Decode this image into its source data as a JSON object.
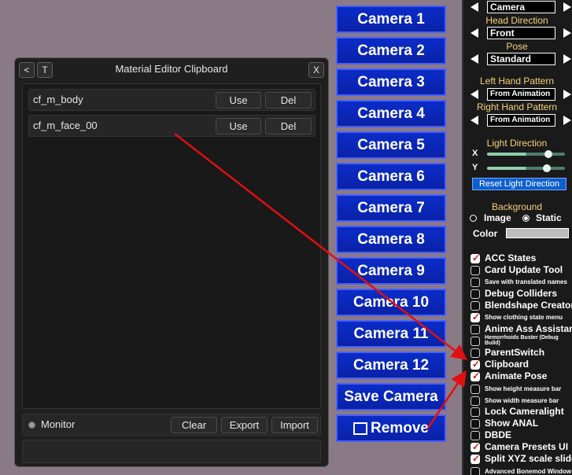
{
  "clipboard": {
    "title": "Material Editor Clipboard",
    "back_label": "<",
    "t_label": "T",
    "close_label": "X",
    "rows": [
      {
        "name": "cf_m_body",
        "use": "Use",
        "del": "Del"
      },
      {
        "name": "cf_m_face_00",
        "use": "Use",
        "del": "Del"
      }
    ],
    "monitor_label": "Monitor",
    "clear_label": "Clear",
    "export_label": "Export",
    "import_label": "Import"
  },
  "cameras": {
    "items": [
      "Camera 1",
      "Camera 2",
      "Camera 3",
      "Camera 4",
      "Camera 5",
      "Camera 6",
      "Camera 7",
      "Camera 8",
      "Camera 9",
      "Camera 10",
      "Camera 11",
      "Camera 12"
    ],
    "save_label": "Save Camera",
    "remove_label": "Remove"
  },
  "right_panel": {
    "camera_value": "Camera",
    "head_direction_label": "Head Direction",
    "head_direction_value": "Front",
    "pose_label": "Pose",
    "pose_value": "Standard",
    "left_hand_label": "Left Hand Pattern",
    "left_hand_value": "From Animation",
    "right_hand_label": "Right Hand Pattern",
    "right_hand_value": "From Animation",
    "light_direction_label": "Light Direction",
    "light_x_label": "X",
    "light_y_label": "Y",
    "light_x_value": 0.5,
    "light_y_value": 0.5,
    "reset_light_label": "Reset Light Direction",
    "background_label": "Background",
    "bg_image_label": "Image",
    "bg_static_label": "Static",
    "bg_selected": "Static",
    "color_label": "Color",
    "color_value": "#bdbdbd",
    "toggles": [
      {
        "label": "ACC States",
        "checked": true
      },
      {
        "label": "Card Update Tool",
        "checked": false
      },
      {
        "label": "Save with translated names",
        "checked": false
      },
      {
        "label": "Debug Colliders",
        "checked": false
      },
      {
        "label": "Blendshape Creator",
        "checked": false
      },
      {
        "label": "Show clothing state menu",
        "checked": true
      },
      {
        "label": "Anime Ass Assistant",
        "checked": false
      },
      {
        "label": "Hemorrhoids Buster (Debug Build)",
        "checked": false
      },
      {
        "label": "ParentSwitch",
        "checked": false
      },
      {
        "label": "Clipboard",
        "checked": true
      },
      {
        "label": "Animate Pose",
        "checked": true
      },
      {
        "label": "Show height measure bar",
        "checked": false
      },
      {
        "label": "Show width measure bar",
        "checked": false
      },
      {
        "label": "Lock Cameralight",
        "checked": false
      },
      {
        "label": "Show ANAL",
        "checked": false
      },
      {
        "label": "DBDE",
        "checked": false
      },
      {
        "label": "Camera Presets UI",
        "checked": true
      },
      {
        "label": "Split XYZ scale sliders",
        "checked": true
      },
      {
        "label": "Advanced Bonemod Window",
        "checked": false
      }
    ]
  },
  "annotation_color": "#e01010"
}
